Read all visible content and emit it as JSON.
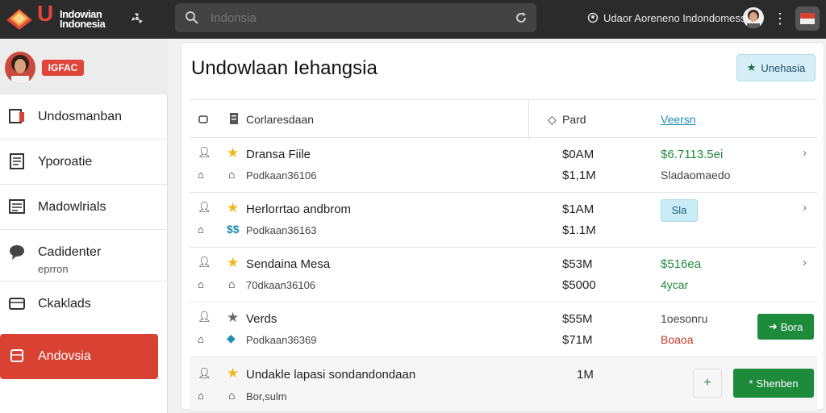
{
  "topbar": {
    "brand_line1": "Indowian",
    "brand_line2": "Indonesia",
    "search_placeholder": "Indonsia",
    "user_text": "Udaor Aoreneno Indondomess"
  },
  "sidebar": {
    "badge": "IGFAC",
    "items": [
      {
        "label": "Undosmanban",
        "icon": "book-icon"
      },
      {
        "label": "Yporoatie",
        "icon": "document-icon"
      },
      {
        "label": "Madowlrials",
        "icon": "list-icon"
      },
      {
        "label": "Cadidenter",
        "sub": "eprron",
        "icon": "chat-icon"
      },
      {
        "label": "Ckaklads",
        "icon": "folder-icon"
      },
      {
        "label": "Andovsia",
        "icon": "stack-icon",
        "active": true
      }
    ]
  },
  "main": {
    "title": "Undowlaan Iehangsia",
    "top_button": "Unehasia",
    "headers": {
      "name": "Corlaresdaan",
      "paid": "Pard",
      "version": "Veersn"
    },
    "rows": [
      {
        "name": "Dransa Fiile",
        "sub": "Podkaan36106",
        "amount1": "$0AM",
        "amount2": "$1,1M",
        "status1": "$6.7113.5ei",
        "status2": "Sladaomaedo"
      },
      {
        "name": "Herlorrtao andbrom",
        "sub": "Podkaan36163",
        "amount1": "$1AM",
        "amount2": "$1.1M",
        "pill": "Sla"
      },
      {
        "name": "Sendaina Mesa",
        "sub": "70dkaan36106",
        "amount1": "$53M",
        "amount2": "$5000",
        "status1": "$516ea",
        "status2": "4ycar"
      },
      {
        "name": "Verds",
        "sub": "Podkaan36369",
        "amount1": "$55M",
        "amount2": "$71M",
        "status1": "1oesonru",
        "status2": "Boaoa",
        "button": "Bora"
      },
      {
        "name": "Undakle lapasi sondandondaan",
        "sub": "Bor,sulm",
        "amount1": "1M",
        "button_sq": "+",
        "button": "Shenben"
      }
    ]
  },
  "colors": {
    "topbar": "#2b2b2b",
    "accent_red": "#d94132",
    "accent_green": "#1e8a3c",
    "accent_cyan": "#c9ecf7"
  }
}
